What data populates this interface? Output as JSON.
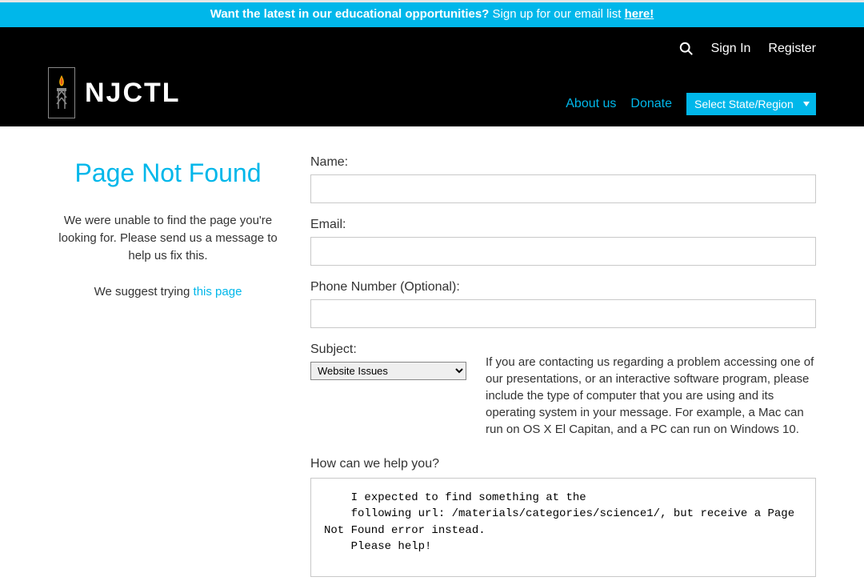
{
  "announcement": {
    "bold_text": "Want the latest in our educational opportunities?",
    "normal_text": " Sign up for our email list ",
    "link_text": "here!"
  },
  "header": {
    "logo_text": "NJCTL",
    "search_label": "Search",
    "sign_in": "Sign In",
    "register": "Register",
    "about": "About us",
    "donate": "Donate",
    "region_selected": "Select State/Region"
  },
  "left": {
    "title": "Page Not Found",
    "p1": "We were unable to find the page you're looking for. Please send us a message to help us fix this.",
    "p2_a": "We suggest trying ",
    "p2_link": "this page"
  },
  "form": {
    "name_label": "Name:",
    "name_value": "",
    "email_label": "Email:",
    "email_value": "",
    "phone_label": "Phone Number (Optional):",
    "phone_value": "",
    "subject_label": "Subject:",
    "subject_selected": "Website Issues",
    "note": "If you are contacting us regarding a problem accessing one of our presentations, or an interactive software program, please include the type of computer that you are using and its operating system in your message. For example, a Mac can run on OS X El Capitan, and a PC can run on Windows 10.",
    "help_label": "How can we help you?",
    "help_value": "    I expected to find something at the\n    following url: /materials/categories/science1/, but receive a Page Not Found error instead.\n    Please help!"
  }
}
